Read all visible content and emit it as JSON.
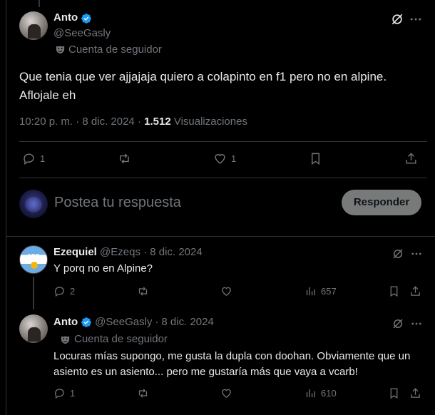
{
  "main_post": {
    "author_name": "Anto",
    "author_handle": "@SeeGasly",
    "follower_label": "Cuenta de seguidor",
    "text_line1": "Que tenia que ver ajjajaja quiero a colapinto en f1 pero no en alpine.",
    "text_line2": "Aflojale eh",
    "time": "10:20 p. m.",
    "dot": "·",
    "date": "8 dic. 2024",
    "views_count": "1.512",
    "views_label": "Visualizaciones",
    "reply_count": "1",
    "like_count": "1"
  },
  "composer": {
    "placeholder": "Postea tu respuesta",
    "button_label": "Responder"
  },
  "replies": [
    {
      "author_name": "Ezequiel",
      "author_handle": "@Ezeqs",
      "dot": "·",
      "date": "8 dic. 2024",
      "avatar_text": "ARG",
      "text": "Y porq no en Alpine?",
      "reply_count": "2",
      "views": "657"
    },
    {
      "author_name": "Anto",
      "author_handle": "@SeeGasly",
      "dot": "·",
      "date": "8 dic. 2024",
      "follower_label": "Cuenta de seguidor",
      "text_line1": "Locuras mías supongo, me gusta la dupla con doohan. Obviamente que un",
      "text_line2": "asiento es un asiento... pero me gustaría más que vaya a vcarb!",
      "reply_count": "1",
      "views": "610"
    }
  ],
  "colors": {
    "background": "#000000",
    "verified": "#1d9bf0",
    "muted": "#71767b",
    "text": "#e7e9ea",
    "divider": "#2f3336"
  }
}
